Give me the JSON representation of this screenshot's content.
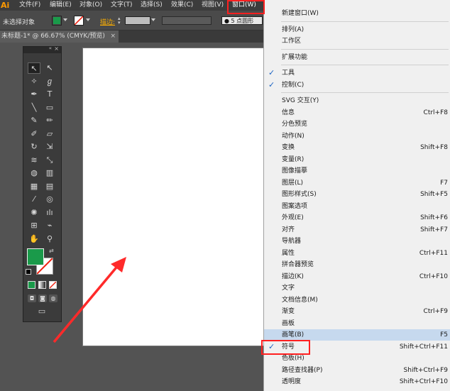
{
  "app_logo": "Ai",
  "menubar": [
    {
      "label": "文件(F)"
    },
    {
      "label": "编辑(E)"
    },
    {
      "label": "对象(O)"
    },
    {
      "label": "文字(T)"
    },
    {
      "label": "选择(S)"
    },
    {
      "label": "效果(C)"
    },
    {
      "label": "视图(V)"
    },
    {
      "label": "窗口(W)"
    }
  ],
  "control": {
    "selection": "未选择对象",
    "stroke_label": "描边:",
    "stroke_size": "5",
    "brush": "点圆形"
  },
  "doc_tab": "未标题-1* @ 66.67% (CMYK/预览)",
  "dropdown": [
    {
      "label": "新建窗口(W)",
      "shortcut": "",
      "checked": false
    },
    {
      "sep": true
    },
    {
      "label": "排列(A)",
      "shortcut": "",
      "checked": false
    },
    {
      "label": "工作区",
      "shortcut": "",
      "checked": false
    },
    {
      "sep": true
    },
    {
      "label": "扩展功能",
      "shortcut": "",
      "checked": false
    },
    {
      "sep": true
    },
    {
      "label": "工具",
      "shortcut": "",
      "checked": true
    },
    {
      "label": "控制(C)",
      "shortcut": "",
      "checked": true
    },
    {
      "sep": true
    },
    {
      "label": "SVG 交互(Y)",
      "shortcut": "",
      "checked": false
    },
    {
      "label": "信息",
      "shortcut": "Ctrl+F8",
      "checked": false
    },
    {
      "label": "分色预览",
      "shortcut": "",
      "checked": false
    },
    {
      "label": "动作(N)",
      "shortcut": "",
      "checked": false
    },
    {
      "label": "变换",
      "shortcut": "Shift+F8",
      "checked": false
    },
    {
      "label": "变量(R)",
      "shortcut": "",
      "checked": false
    },
    {
      "label": "图像描摹",
      "shortcut": "",
      "checked": false
    },
    {
      "label": "图层(L)",
      "shortcut": "F7",
      "checked": false
    },
    {
      "label": "图形样式(S)",
      "shortcut": "Shift+F5",
      "checked": false
    },
    {
      "label": "图案选项",
      "shortcut": "",
      "checked": false
    },
    {
      "label": "外观(E)",
      "shortcut": "Shift+F6",
      "checked": false
    },
    {
      "label": "对齐",
      "shortcut": "Shift+F7",
      "checked": false
    },
    {
      "label": "导航器",
      "shortcut": "",
      "checked": false
    },
    {
      "label": "属性",
      "shortcut": "Ctrl+F11",
      "checked": false
    },
    {
      "label": "拼合器预览",
      "shortcut": "",
      "checked": false
    },
    {
      "label": "描边(K)",
      "shortcut": "Ctrl+F10",
      "checked": false
    },
    {
      "label": "文字",
      "shortcut": "",
      "checked": false
    },
    {
      "label": "文档信息(M)",
      "shortcut": "",
      "checked": false
    },
    {
      "label": "渐变",
      "shortcut": "Ctrl+F9",
      "checked": false
    },
    {
      "label": "画板",
      "shortcut": "",
      "checked": false
    },
    {
      "label": "画笔(B)",
      "shortcut": "F5",
      "checked": false,
      "highlight": true
    },
    {
      "label": "符号",
      "shortcut": "Shift+Ctrl+F11",
      "checked": true
    },
    {
      "label": "色板(H)",
      "shortcut": "",
      "checked": false
    },
    {
      "label": "路径查找器(P)",
      "shortcut": "Shift+Ctrl+F9",
      "checked": false
    },
    {
      "label": "透明度",
      "shortcut": "Shift+Ctrl+F10",
      "checked": false
    }
  ],
  "colors": {
    "fill": "#1a9a4a",
    "annotation": "#ff2a2a",
    "check": "#1b64c4"
  },
  "icons": [
    "selection-icon",
    "direct-selection-icon",
    "magic-wand-icon",
    "lasso-icon",
    "pen-icon",
    "type-icon",
    "line-icon",
    "rectangle-icon",
    "brush-icon",
    "pencil-icon",
    "blob-brush-icon",
    "eraser-icon",
    "rotate-icon",
    "scale-icon",
    "width-icon",
    "free-transform-icon",
    "shape-builder-icon",
    "chart-icon",
    "mesh-icon",
    "gradient-icon",
    "eyedropper-icon",
    "blend-icon",
    "symbol-sprayer-icon",
    "column-graph-icon",
    "artboard-icon",
    "slice-icon",
    "hand-icon",
    "zoom-icon"
  ],
  "tool_glyphs": [
    "↖",
    "↖",
    "✧",
    "ℊ",
    "✒",
    "T",
    "╲",
    "▭",
    "✎",
    "✏",
    "✐",
    "▱",
    "↻",
    "⇲",
    "≋",
    "⤡",
    "◍",
    "▥",
    "▦",
    "▤",
    "⁄",
    "◎",
    "✺",
    "ılı",
    "⊞",
    "⌁",
    "✋",
    "⚲"
  ]
}
